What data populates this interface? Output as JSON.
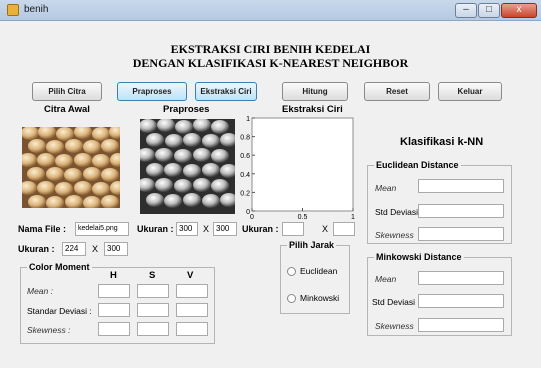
{
  "window": {
    "title": "benih",
    "minimize": "–",
    "maximize": "□",
    "close": "x"
  },
  "heading": {
    "line1": "EKSTRAKSI CIRI BENIH KEDELAI",
    "line2": "DENGAN KLASIFIKASI K-NEAREST NEIGHBOR"
  },
  "toolbar": {
    "pilih_citra": "Pilih Citra",
    "praproses": "Praproses",
    "ekstraksi_ciri": "Ekstraksi Ciri",
    "hitung": "Hitung",
    "reset": "Reset",
    "keluar": "Keluar"
  },
  "panels": {
    "citra_awal": "Citra Awal",
    "praproses": "Praproses",
    "ekstraksi_ciri": "Ekstraksi Ciri"
  },
  "file": {
    "label": "Nama File :",
    "value": "kedelai5.png",
    "ukuran_label": "Ukuran :",
    "width": "224",
    "x": "X",
    "height": "300"
  },
  "praproses_size": {
    "label": "Ukuran :",
    "width": "300",
    "x": "X",
    "height": "300"
  },
  "ekstraksi_size": {
    "label": "Ukuran :",
    "x": "X"
  },
  "chart_data": {
    "type": "line",
    "series": [],
    "xlim": [
      0,
      1
    ],
    "ylim": [
      0,
      1
    ],
    "y_ticks": [
      "1",
      "0.8",
      "0.6",
      "0.4",
      "0.2",
      "0"
    ],
    "x_ticks": [
      "0",
      "0.5",
      "1"
    ],
    "grid": false
  },
  "color_moment": {
    "title": "Color Moment",
    "headers": [
      "H",
      "S",
      "V"
    ],
    "rows": [
      "Mean :",
      "Standar Deviasi :",
      "Skewness :"
    ]
  },
  "pilih_jarak": {
    "title": "Pilih Jarak",
    "options": [
      "Euclidean",
      "Minkowski"
    ]
  },
  "knn": {
    "title": "Klasifikasi k-NN",
    "euclidean": {
      "title": "Euclidean Distance",
      "rows": [
        "Mean",
        "Std Deviasi",
        "Skewness"
      ]
    },
    "minkowski": {
      "title": "Minkowski Distance",
      "rows": [
        "Mean",
        "Std Deviasi",
        "Skewness"
      ]
    }
  }
}
